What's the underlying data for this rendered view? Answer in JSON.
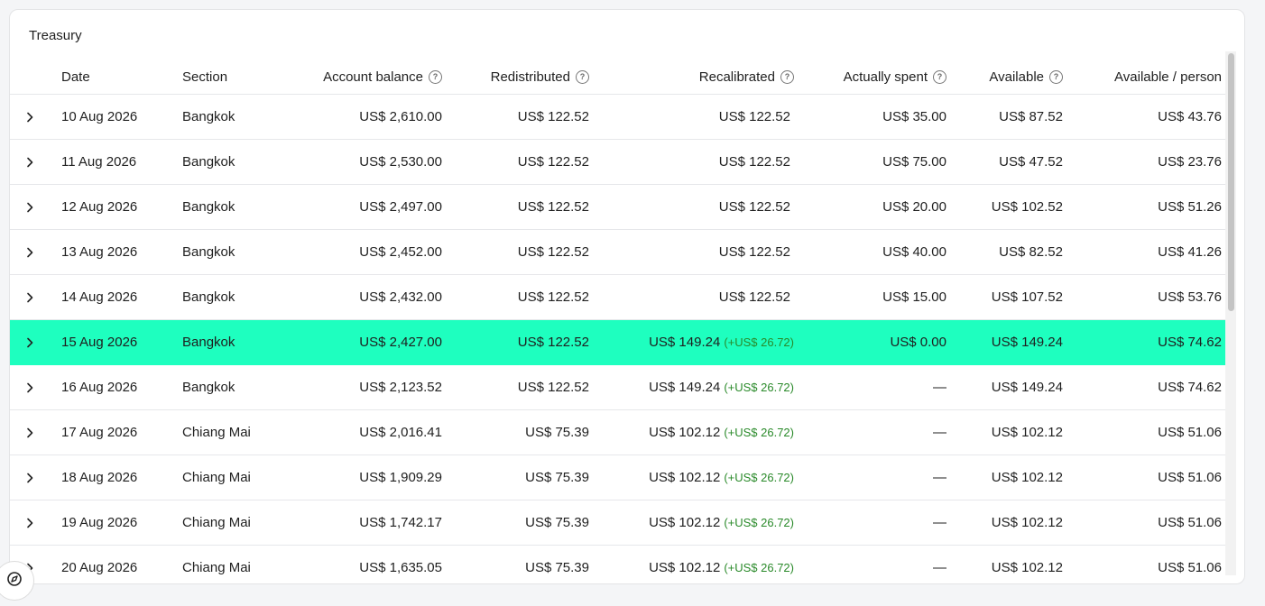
{
  "title": "Treasury",
  "columns": {
    "date": "Date",
    "section": "Section",
    "balance": "Account balance",
    "redistributed": "Redistributed",
    "recalibrated": "Recalibrated",
    "spent": "Actually spent",
    "available": "Available",
    "available_person": "Available / person"
  },
  "rows": [
    {
      "date": "10 Aug 2026",
      "section": "Bangkok",
      "balance": "US$ 2,610.00",
      "redistributed": "US$ 122.52",
      "recalibrated": "US$ 122.52",
      "delta": "",
      "spent": "US$ 35.00",
      "available": "US$ 87.52",
      "available_person": "US$ 43.76"
    },
    {
      "date": "11 Aug 2026",
      "section": "Bangkok",
      "balance": "US$ 2,530.00",
      "redistributed": "US$ 122.52",
      "recalibrated": "US$ 122.52",
      "delta": "",
      "spent": "US$ 75.00",
      "available": "US$ 47.52",
      "available_person": "US$ 23.76"
    },
    {
      "date": "12 Aug 2026",
      "section": "Bangkok",
      "balance": "US$ 2,497.00",
      "redistributed": "US$ 122.52",
      "recalibrated": "US$ 122.52",
      "delta": "",
      "spent": "US$ 20.00",
      "available": "US$ 102.52",
      "available_person": "US$ 51.26"
    },
    {
      "date": "13 Aug 2026",
      "section": "Bangkok",
      "balance": "US$ 2,452.00",
      "redistributed": "US$ 122.52",
      "recalibrated": "US$ 122.52",
      "delta": "",
      "spent": "US$ 40.00",
      "available": "US$ 82.52",
      "available_person": "US$ 41.26"
    },
    {
      "date": "14 Aug 2026",
      "section": "Bangkok",
      "balance": "US$ 2,432.00",
      "redistributed": "US$ 122.52",
      "recalibrated": "US$ 122.52",
      "delta": "",
      "spent": "US$ 15.00",
      "available": "US$ 107.52",
      "available_person": "US$ 53.76"
    },
    {
      "date": "15 Aug 2026",
      "section": "Bangkok",
      "balance": "US$ 2,427.00",
      "redistributed": "US$ 122.52",
      "recalibrated": "US$ 149.24",
      "delta": "(+US$ 26.72)",
      "spent": "US$ 0.00",
      "available": "US$ 149.24",
      "available_person": "US$ 74.62",
      "selected": true
    },
    {
      "date": "16 Aug 2026",
      "section": "Bangkok",
      "balance": "US$ 2,123.52",
      "redistributed": "US$ 122.52",
      "recalibrated": "US$ 149.24",
      "delta": "(+US$ 26.72)",
      "spent": "—",
      "available": "US$ 149.24",
      "available_person": "US$ 74.62"
    },
    {
      "date": "17 Aug 2026",
      "section": "Chiang Mai",
      "balance": "US$ 2,016.41",
      "redistributed": "US$ 75.39",
      "recalibrated": "US$ 102.12",
      "delta": "(+US$ 26.72)",
      "spent": "—",
      "available": "US$ 102.12",
      "available_person": "US$ 51.06"
    },
    {
      "date": "18 Aug 2026",
      "section": "Chiang Mai",
      "balance": "US$ 1,909.29",
      "redistributed": "US$ 75.39",
      "recalibrated": "US$ 102.12",
      "delta": "(+US$ 26.72)",
      "spent": "—",
      "available": "US$ 102.12",
      "available_person": "US$ 51.06"
    },
    {
      "date": "19 Aug 2026",
      "section": "Chiang Mai",
      "balance": "US$ 1,742.17",
      "redistributed": "US$ 75.39",
      "recalibrated": "US$ 102.12",
      "delta": "(+US$ 26.72)",
      "spent": "—",
      "available": "US$ 102.12",
      "available_person": "US$ 51.06"
    },
    {
      "date": "20 Aug 2026",
      "section": "Chiang Mai",
      "balance": "US$ 1,635.05",
      "redistributed": "US$ 75.39",
      "recalibrated": "US$ 102.12",
      "delta": "(+US$ 26.72)",
      "spent": "—",
      "available": "US$ 102.12",
      "available_person": "US$ 51.06"
    }
  ],
  "icons": {
    "help": "question-circle-icon",
    "expand": "chevron-right-icon",
    "fab": "compass-icon"
  },
  "colors": {
    "selected_row": "#1effbf",
    "delta": "#2a8a2a"
  }
}
